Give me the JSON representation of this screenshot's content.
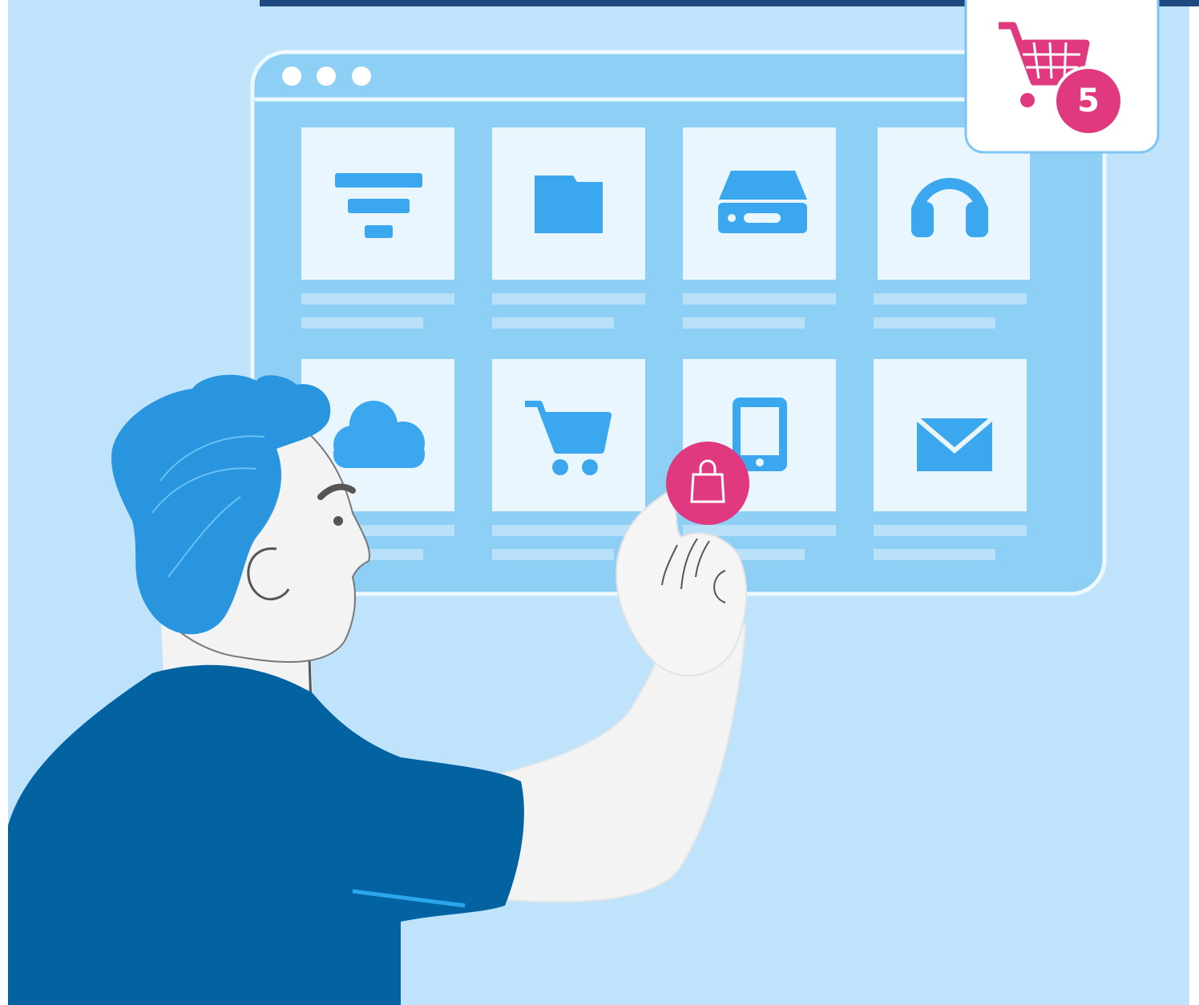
{
  "scene": {
    "colors": {
      "background": "#bfe3fa",
      "window": "#8ecff6",
      "card": "#eaf6fe",
      "icon_blue": "#3ba7ee",
      "accent_pink": "#e0397f",
      "shirt": "#0263a0",
      "hair": "#2a95df",
      "skin": "#f3f3f3",
      "top_bar": "#1f4a80"
    },
    "browser_window": {
      "dots": [
        "dot",
        "dot",
        "dot"
      ]
    },
    "product_grid": [
      {
        "icon": "filter-icon"
      },
      {
        "icon": "folder-icon"
      },
      {
        "icon": "hard-drive-icon"
      },
      {
        "icon": "headphones-icon"
      },
      {
        "icon": "cloud-icon"
      },
      {
        "icon": "shopping-cart-icon"
      },
      {
        "icon": "smartphone-icon"
      },
      {
        "icon": "mail-icon"
      }
    ],
    "cart_widget": {
      "icon": "shopping-cart-icon",
      "badge_count": "5"
    },
    "shopping_bag_button": {
      "icon": "shopping-bag-icon"
    }
  }
}
